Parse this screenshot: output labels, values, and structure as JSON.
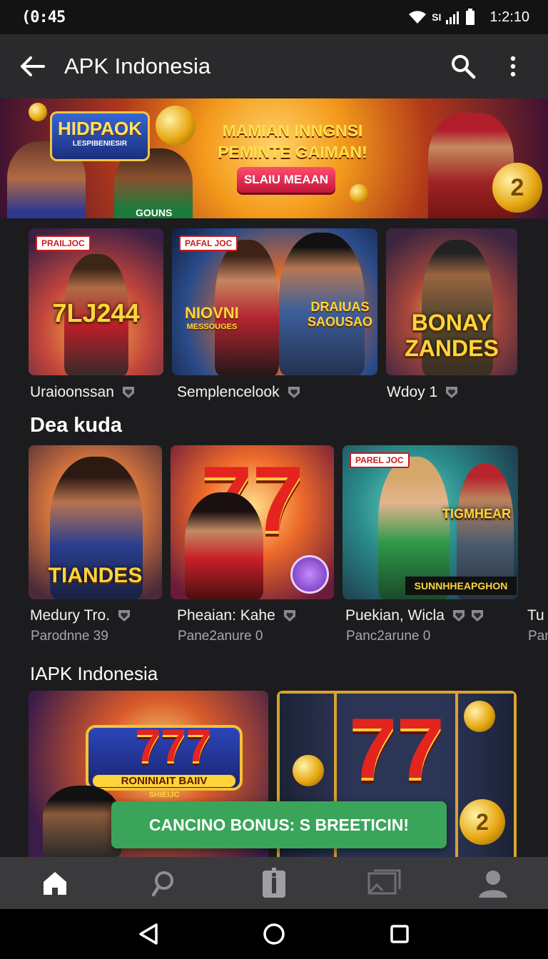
{
  "status_bar": {
    "time": "(0:45",
    "signal_text": "SI",
    "clock": "1:2:10"
  },
  "app_bar": {
    "title": "APK Indonesia",
    "icons": [
      "arrow-back-icon",
      "search-icon",
      "more-vert-icon"
    ]
  },
  "banner": {
    "logo_text": "HIDPAOK",
    "logo_sub": "LESPIBENIESIR",
    "headline": "MAMIAN INNGNSI PEMINTE GAIMAN!",
    "button_label": "SLAIU MEAAN",
    "shirt_text": "GOUNS",
    "coin_label": "2"
  },
  "row1": {
    "cards": [
      {
        "badge": "PRAILJOC",
        "art_text": "7LJ244",
        "caption": "Uraioonssan"
      },
      {
        "badge": "PAFAL JOC",
        "art_text_left": "NIOVNI",
        "art_text_left_sub": "MESSOUGES",
        "art_text_right": "DRAIUAS",
        "art_text_right_sub": "SAOUSAO",
        "caption": "Semplencelook"
      },
      {
        "badge": "",
        "art_text": "BONAY ZANDES",
        "caption": "Wdoy 1"
      }
    ]
  },
  "section2": {
    "title": "Dea kuda",
    "cards": [
      {
        "art_text": "TIANDES",
        "caption": "Medury Tro.",
        "sub": "Parodnne 39"
      },
      {
        "art_text": "77",
        "caption": "Pheaian: Kahe",
        "sub": "Pane2anure 0"
      },
      {
        "badge": "PAREL JOC",
        "art_text": "TIGMHEAR",
        "art_strip": "SUNNHHEAPGHON",
        "caption": "Puekian, Wicla",
        "sub": "Panc2arune 0"
      },
      {
        "caption": "Tu",
        "sub": "Par"
      }
    ]
  },
  "section3": {
    "title": "IAPK Indonesia",
    "cards": [
      {
        "art_text": "777",
        "art_sub": "RONINIAIT BAIIV",
        "art_sub2": "SHIEIJC"
      },
      {
        "art_text": "77",
        "coin_label": "2"
      }
    ]
  },
  "toast": {
    "text": "CANCINO BONUS: S BREETICIN!"
  },
  "bottom_nav": {
    "items": [
      "home-icon",
      "search-icon",
      "info-icon",
      "library-icon",
      "profile-icon"
    ],
    "active": "home"
  },
  "colors": {
    "accent": "#3aa55a",
    "background": "#1c1c1e",
    "appbar": "#2a2a2c",
    "navbar": "#3a3a3c"
  }
}
